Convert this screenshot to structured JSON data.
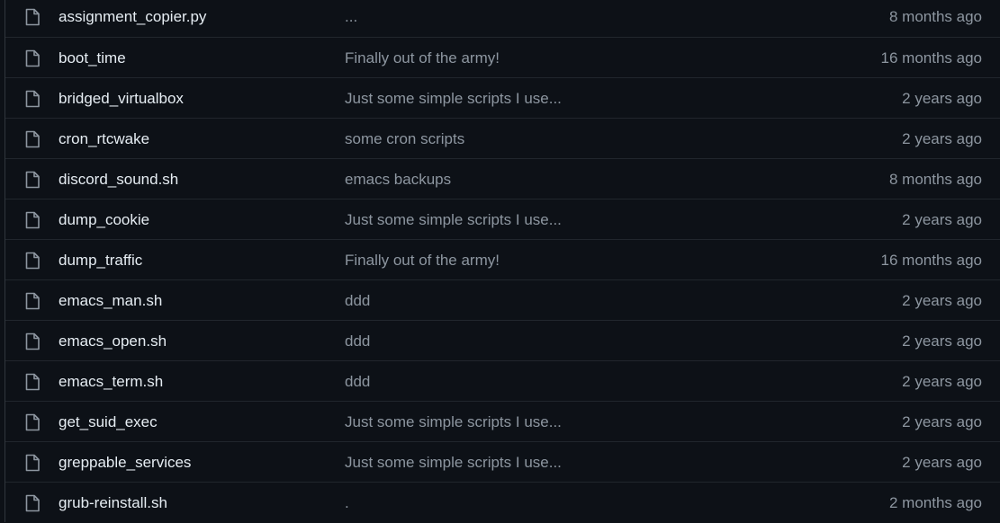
{
  "files": [
    {
      "icon": "file-icon",
      "name": "assignment_copier.py",
      "message": "...",
      "age": "8 months ago"
    },
    {
      "icon": "file-icon",
      "name": "boot_time",
      "message": "Finally out of the army!",
      "age": "16 months ago"
    },
    {
      "icon": "file-icon",
      "name": "bridged_virtualbox",
      "message": "Just some simple scripts I use...",
      "age": "2 years ago"
    },
    {
      "icon": "file-icon",
      "name": "cron_rtcwake",
      "message": "some cron scripts",
      "age": "2 years ago"
    },
    {
      "icon": "file-icon",
      "name": "discord_sound.sh",
      "message": "emacs backups",
      "age": "8 months ago"
    },
    {
      "icon": "file-icon",
      "name": "dump_cookie",
      "message": "Just some simple scripts I use...",
      "age": "2 years ago"
    },
    {
      "icon": "file-icon",
      "name": "dump_traffic",
      "message": "Finally out of the army!",
      "age": "16 months ago"
    },
    {
      "icon": "file-icon",
      "name": "emacs_man.sh",
      "message": "ddd",
      "age": "2 years ago"
    },
    {
      "icon": "file-icon",
      "name": "emacs_open.sh",
      "message": "ddd",
      "age": "2 years ago"
    },
    {
      "icon": "file-icon",
      "name": "emacs_term.sh",
      "message": "ddd",
      "age": "2 years ago"
    },
    {
      "icon": "file-icon",
      "name": "get_suid_exec",
      "message": "Just some simple scripts I use...",
      "age": "2 years ago"
    },
    {
      "icon": "file-icon",
      "name": "greppable_services",
      "message": "Just some simple scripts I use...",
      "age": "2 years ago"
    },
    {
      "icon": "file-icon",
      "name": "grub-reinstall.sh",
      "message": ".",
      "age": "2 months ago"
    }
  ],
  "colors": {
    "background": "#0d1117",
    "row_border": "#21262d",
    "file_name": "#e6edf3",
    "muted_text": "#8d96a0",
    "icon": "#8d96a0"
  }
}
